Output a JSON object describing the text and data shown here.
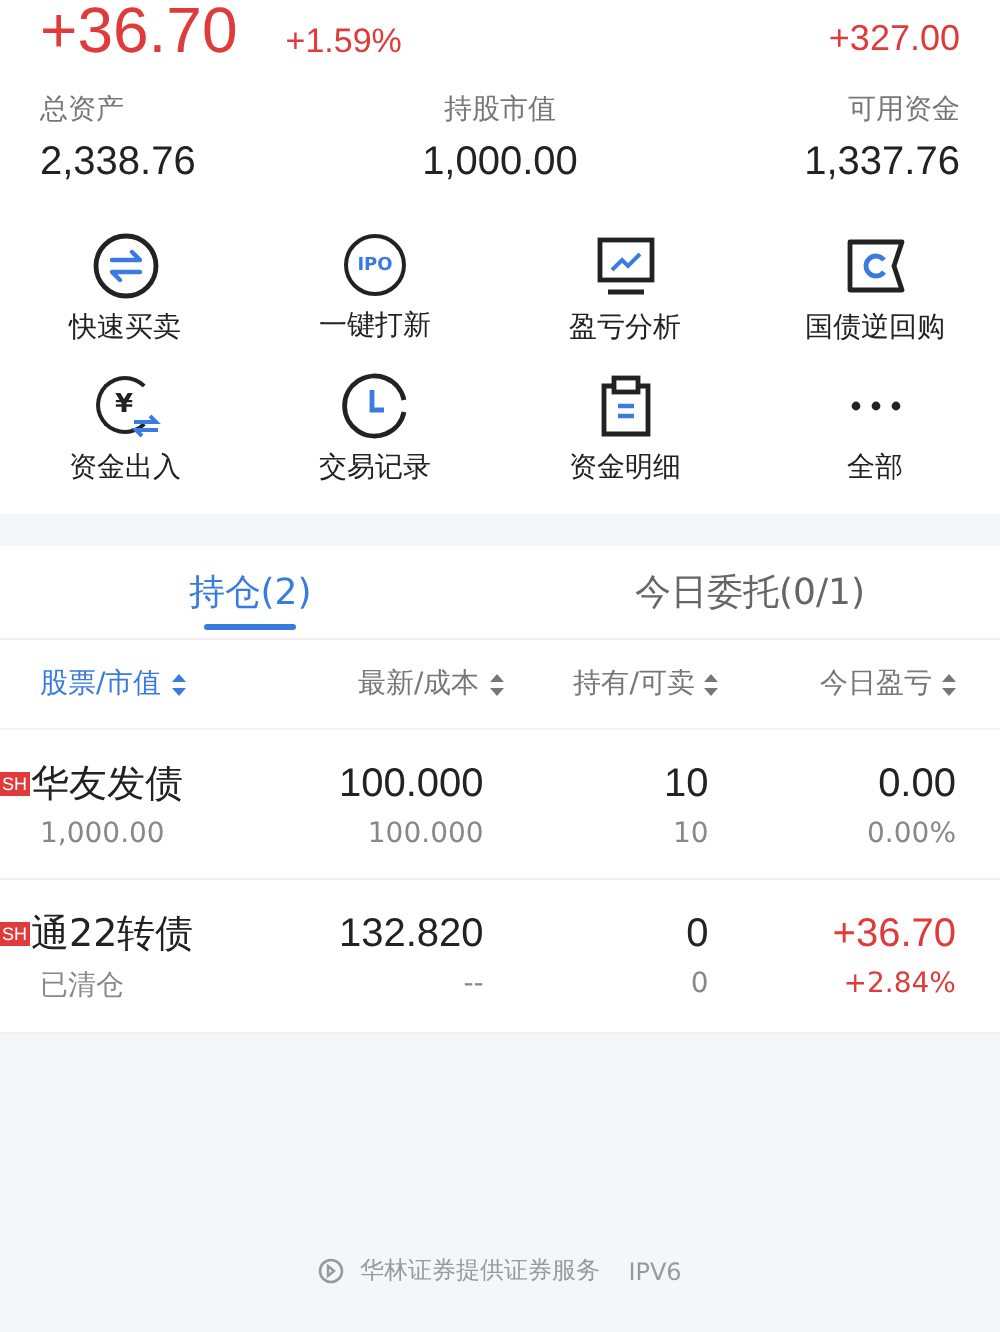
{
  "summary": {
    "profit": "+36.70",
    "profit_pct": "+1.59%",
    "right_value": "+327.00"
  },
  "stats": [
    {
      "label": "总资产",
      "value": "2,338.76"
    },
    {
      "label": "持股市值",
      "value": "1,000.00"
    },
    {
      "label": "可用资金",
      "value": "1,337.76"
    }
  ],
  "shortcuts": [
    {
      "kind": "swap",
      "label": "快速买卖"
    },
    {
      "kind": "ipo",
      "label": "一键打新",
      "icon_text": "IPO"
    },
    {
      "kind": "chart",
      "label": "盈亏分析"
    },
    {
      "kind": "bond",
      "label": "国债逆回购"
    },
    {
      "kind": "money",
      "label": "资金出入",
      "icon_text": "¥"
    },
    {
      "kind": "clock",
      "label": "交易记录"
    },
    {
      "kind": "clipboard",
      "label": "资金明细"
    },
    {
      "kind": "more",
      "label": "全部"
    }
  ],
  "tabs": [
    {
      "label": "持仓(2)",
      "selected": true
    },
    {
      "label": "今日委托(0/1)",
      "selected": false
    }
  ],
  "columns": [
    {
      "label": "股票/市值",
      "active": true
    },
    {
      "label": "最新/成本",
      "active": false
    },
    {
      "label": "持有/可卖",
      "active": false
    },
    {
      "label": "今日盈亏",
      "active": false
    }
  ],
  "rows": [
    {
      "market": "SH",
      "name": "华友发债",
      "sub": "1,000.00",
      "price": "100.000",
      "cost": "100.000",
      "hold": "10",
      "sellable": "10",
      "pnl": "0.00",
      "pnl_pct": "0.00%",
      "kind": "flat"
    },
    {
      "market": "SH",
      "name": "通22转债",
      "sub": "已清仓",
      "price": "132.820",
      "cost": "--",
      "hold": "0",
      "sellable": "0",
      "pnl": "+36.70",
      "pnl_pct": "+2.84%",
      "kind": "up"
    }
  ],
  "footer": {
    "text": "华林证券提供证券服务",
    "suffix": "IPV6"
  }
}
